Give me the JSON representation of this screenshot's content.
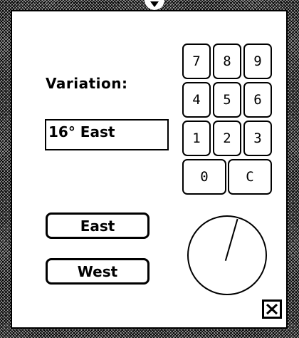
{
  "variation": {
    "label": "Variation:",
    "value": "16° East",
    "degrees": 16
  },
  "keypad": {
    "keys": [
      "7",
      "8",
      "9",
      "4",
      "5",
      "6",
      "1",
      "2",
      "3",
      "0",
      "C"
    ]
  },
  "direction_buttons": {
    "east_label": "East",
    "west_label": "West"
  },
  "icons": {
    "close": "close-box-icon",
    "compass": "compass-dial-icon",
    "notch": "window-notch-icon"
  }
}
